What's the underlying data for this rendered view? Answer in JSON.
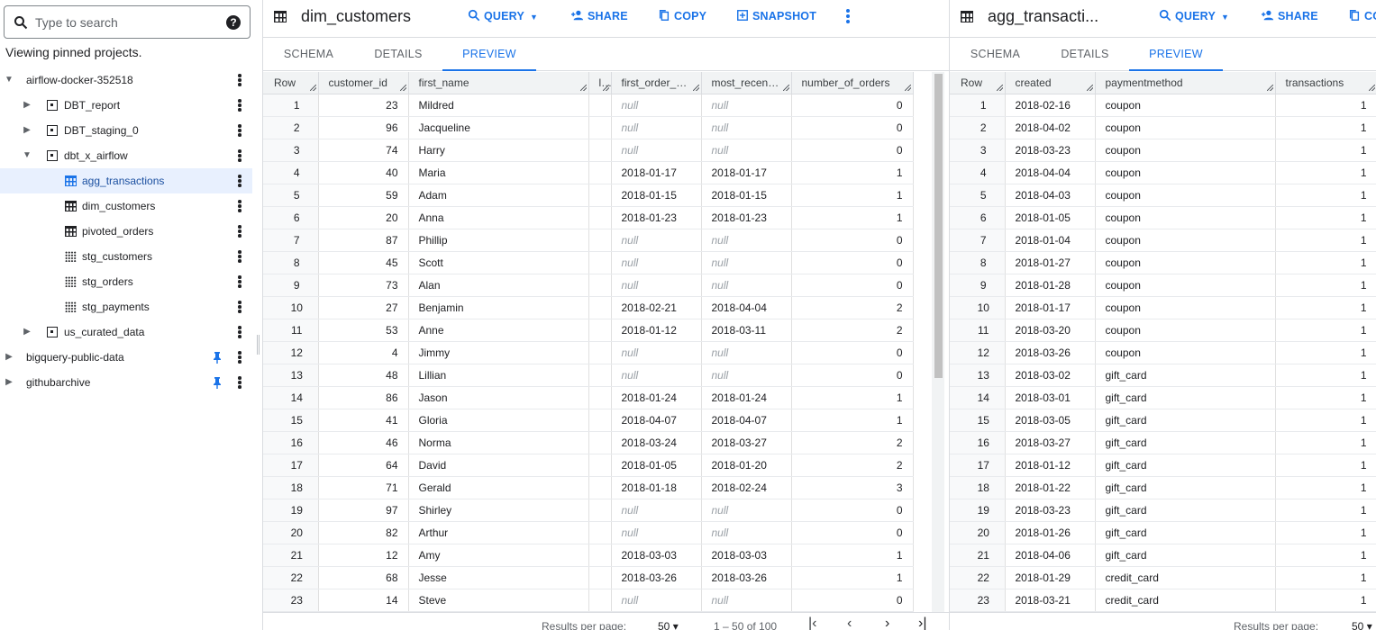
{
  "search": {
    "placeholder": "Type to search"
  },
  "pinned_note": "Viewing pinned projects.",
  "tree": [
    {
      "label": "airflow-docker-352518",
      "level": 0,
      "kind": "project",
      "expanded": true,
      "pinned": false
    },
    {
      "label": "DBT_report",
      "level": 1,
      "kind": "dataset",
      "expanded": false
    },
    {
      "label": "DBT_staging_0",
      "level": 1,
      "kind": "dataset",
      "expanded": false
    },
    {
      "label": "dbt_x_airflow",
      "level": 1,
      "kind": "dataset",
      "expanded": true
    },
    {
      "label": "agg_transactions",
      "level": 2,
      "kind": "table",
      "selected": true
    },
    {
      "label": "dim_customers",
      "level": 2,
      "kind": "table"
    },
    {
      "label": "pivoted_orders",
      "level": 2,
      "kind": "table"
    },
    {
      "label": "stg_customers",
      "level": 2,
      "kind": "view"
    },
    {
      "label": "stg_orders",
      "level": 2,
      "kind": "view"
    },
    {
      "label": "stg_payments",
      "level": 2,
      "kind": "view"
    },
    {
      "label": "us_curated_data",
      "level": 1,
      "kind": "dataset",
      "expanded": false
    },
    {
      "label": "bigquery-public-data",
      "level": 0,
      "kind": "project",
      "expanded": false,
      "pinned": true
    },
    {
      "label": "githubarchive",
      "level": 0,
      "kind": "project",
      "expanded": false,
      "pinned": true
    }
  ],
  "left_panel": {
    "title": "dim_customers",
    "buttons": {
      "query": "QUERY",
      "share": "SHARE",
      "copy": "COPY",
      "snapshot": "SNAPSHOT"
    },
    "tabs": [
      "SCHEMA",
      "DETAILS",
      "PREVIEW"
    ],
    "active_tab": "PREVIEW",
    "columns": [
      "Row",
      "customer_id",
      "first_name",
      "last_name",
      "first_order_date",
      "most_recent_order_date",
      "number_of_orders"
    ],
    "rows": [
      [
        1,
        23,
        "Mildred",
        "",
        "null",
        "null",
        0
      ],
      [
        2,
        96,
        "Jacqueline",
        "",
        "null",
        "null",
        0
      ],
      [
        3,
        74,
        "Harry",
        "",
        "null",
        "null",
        0
      ],
      [
        4,
        40,
        "Maria",
        "",
        "2018-01-17",
        "2018-01-17",
        1
      ],
      [
        5,
        59,
        "Adam",
        "",
        "2018-01-15",
        "2018-01-15",
        1
      ],
      [
        6,
        20,
        "Anna",
        "",
        "2018-01-23",
        "2018-01-23",
        1
      ],
      [
        7,
        87,
        "Phillip",
        "",
        "null",
        "null",
        0
      ],
      [
        8,
        45,
        "Scott",
        "",
        "null",
        "null",
        0
      ],
      [
        9,
        73,
        "Alan",
        "",
        "null",
        "null",
        0
      ],
      [
        10,
        27,
        "Benjamin",
        "",
        "2018-02-21",
        "2018-04-04",
        2
      ],
      [
        11,
        53,
        "Anne",
        "",
        "2018-01-12",
        "2018-03-11",
        2
      ],
      [
        12,
        4,
        "Jimmy",
        "",
        "null",
        "null",
        0
      ],
      [
        13,
        48,
        "Lillian",
        "",
        "null",
        "null",
        0
      ],
      [
        14,
        86,
        "Jason",
        "",
        "2018-01-24",
        "2018-01-24",
        1
      ],
      [
        15,
        41,
        "Gloria",
        "",
        "2018-04-07",
        "2018-04-07",
        1
      ],
      [
        16,
        46,
        "Norma",
        "",
        "2018-03-24",
        "2018-03-27",
        2
      ],
      [
        17,
        64,
        "David",
        "",
        "2018-01-05",
        "2018-01-20",
        2
      ],
      [
        18,
        71,
        "Gerald",
        "",
        "2018-01-18",
        "2018-02-24",
        3
      ],
      [
        19,
        97,
        "Shirley",
        "",
        "null",
        "null",
        0
      ],
      [
        20,
        82,
        "Arthur",
        "",
        "null",
        "null",
        0
      ],
      [
        21,
        12,
        "Amy",
        "",
        "2018-03-03",
        "2018-03-03",
        1
      ],
      [
        22,
        68,
        "Jesse",
        "",
        "2018-03-26",
        "2018-03-26",
        1
      ],
      [
        23,
        14,
        "Steve",
        "",
        "null",
        "null",
        0
      ]
    ],
    "footer": {
      "results_per_page_label": "Results per page:",
      "results_per_page": "50",
      "range": "1 – 50 of 100"
    }
  },
  "right_panel": {
    "title": "agg_transacti...",
    "buttons": {
      "query": "QUERY",
      "share": "SHARE",
      "copy": "CO"
    },
    "tabs": [
      "SCHEMA",
      "DETAILS",
      "PREVIEW"
    ],
    "active_tab": "PREVIEW",
    "columns": [
      "Row",
      "created",
      "paymentmethod",
      "transactions"
    ],
    "rows": [
      [
        1,
        "2018-02-16",
        "coupon",
        1
      ],
      [
        2,
        "2018-04-02",
        "coupon",
        1
      ],
      [
        3,
        "2018-03-23",
        "coupon",
        1
      ],
      [
        4,
        "2018-04-04",
        "coupon",
        1
      ],
      [
        5,
        "2018-04-03",
        "coupon",
        1
      ],
      [
        6,
        "2018-01-05",
        "coupon",
        1
      ],
      [
        7,
        "2018-01-04",
        "coupon",
        1
      ],
      [
        8,
        "2018-01-27",
        "coupon",
        1
      ],
      [
        9,
        "2018-01-28",
        "coupon",
        1
      ],
      [
        10,
        "2018-01-17",
        "coupon",
        1
      ],
      [
        11,
        "2018-03-20",
        "coupon",
        1
      ],
      [
        12,
        "2018-03-26",
        "coupon",
        1
      ],
      [
        13,
        "2018-03-02",
        "gift_card",
        1
      ],
      [
        14,
        "2018-03-01",
        "gift_card",
        1
      ],
      [
        15,
        "2018-03-05",
        "gift_card",
        1
      ],
      [
        16,
        "2018-03-27",
        "gift_card",
        1
      ],
      [
        17,
        "2018-01-12",
        "gift_card",
        1
      ],
      [
        18,
        "2018-01-22",
        "gift_card",
        1
      ],
      [
        19,
        "2018-03-23",
        "gift_card",
        1
      ],
      [
        20,
        "2018-01-26",
        "gift_card",
        1
      ],
      [
        21,
        "2018-04-06",
        "gift_card",
        1
      ],
      [
        22,
        "2018-01-29",
        "credit_card",
        1
      ],
      [
        23,
        "2018-03-21",
        "credit_card",
        1
      ]
    ],
    "footer": {
      "results_per_page_label": "Results per page:",
      "results_per_page": "50"
    }
  },
  "colors": {
    "accent": "#1a73e8",
    "selected_bg": "#e8f0fe",
    "header_bg": "#f1f3f4",
    "null_text": "#9aa0a6"
  },
  "icons": {
    "search": "search-icon",
    "help": "help-icon",
    "pin": "pin-icon",
    "more": "more-vert-icon",
    "table": "table-icon",
    "view": "view-icon",
    "dataset": "dataset-icon"
  }
}
